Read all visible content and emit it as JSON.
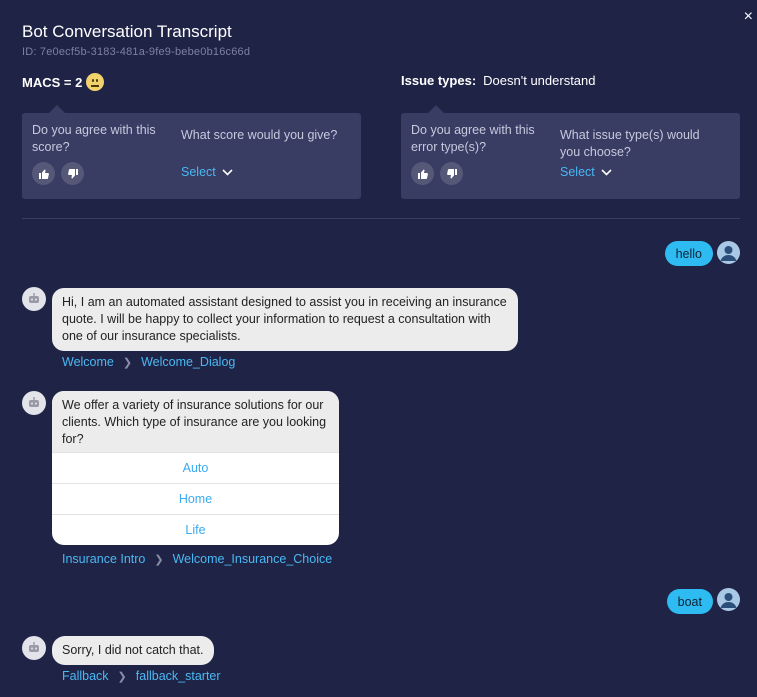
{
  "dialog": {
    "title": "Bot Conversation Transcript",
    "id_text": "ID: 7e0ecf5b-3183-481a-9fe9-bebe0b16c66d",
    "close_glyph": "×"
  },
  "macs": {
    "label": "MACS = 2",
    "emoji": "neutral-face-icon"
  },
  "issue_types": {
    "label": "Issue types:",
    "value": "Doesn't understand"
  },
  "score_card": {
    "question_agree": "Do you agree with this score?",
    "question_score": "What score would you give?",
    "select_label": "Select"
  },
  "error_card": {
    "question_agree": "Do you agree with this error type(s)?",
    "question_issue": "What issue type(s) would you choose?",
    "select_label": "Select"
  },
  "transcript": {
    "user_msg_1": "hello",
    "bot_msg_1": "Hi, I am an automated assistant designed to assist you in receiving an insurance quote. I will be happy to collect your information to request a consultation with one of our insurance specialists.",
    "crumb_1": {
      "intent": "Welcome",
      "node": "Welcome_Dialog"
    },
    "bot_msg_2": "We offer a variety of insurance solutions for our clients. Which type of insurance are you looking for?",
    "choices": [
      "Auto",
      "Home",
      "Life"
    ],
    "crumb_2": {
      "intent": "Insurance Intro",
      "node": "Welcome_Insurance_Choice"
    },
    "user_msg_2": "boat",
    "bot_msg_3": "Sorry, I did not catch that.",
    "crumb_3": {
      "intent": "Fallback",
      "node": "fallback_starter"
    }
  },
  "colors": {
    "background": "#1f2346",
    "card": "#393c63",
    "accent": "#4ab8f3",
    "user_bubble": "#2dbbf1",
    "bot_bubble": "#ececec"
  }
}
